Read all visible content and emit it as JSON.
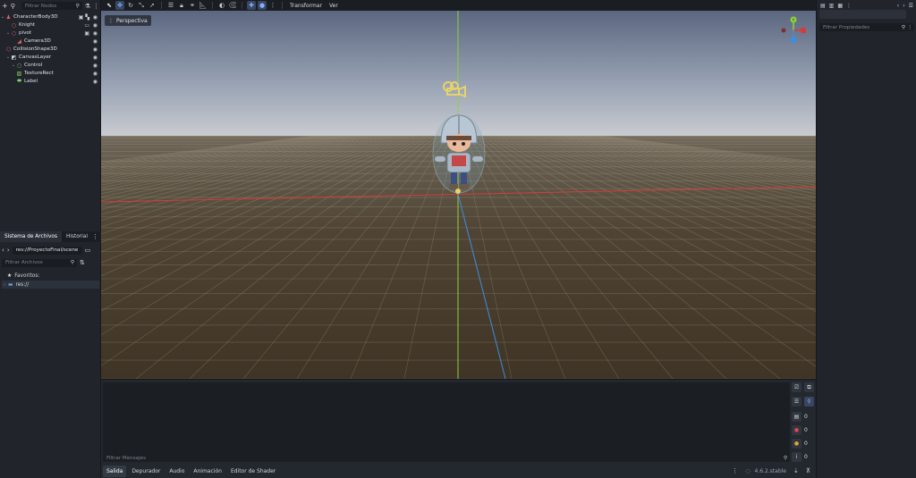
{
  "scene_panel": {
    "filter_placeholder": "Filtrar Nodos",
    "nodes": [
      {
        "label": "CharacterBody3D"
      },
      {
        "label": "Knight"
      },
      {
        "label": "pivot"
      },
      {
        "label": "Camera3D"
      },
      {
        "label": "CollisionShape3D"
      },
      {
        "label": "CanvasLayer"
      },
      {
        "label": "Control"
      },
      {
        "label": "TextureRect"
      },
      {
        "label": "Label"
      }
    ]
  },
  "filesystem_panel": {
    "tab_active": "Sistema de Archivos",
    "tab_other": "Historial",
    "path": "res://ProyectoFinal/scene",
    "filter_placeholder": "Filtrar Archivos",
    "favorites_label": "Favoritos:",
    "root_label": "res://"
  },
  "toolbar": {
    "transform_label": "Transformar",
    "view_label": "Ver"
  },
  "viewport": {
    "perspective_label": "Perspectiva",
    "gizmo_axis_label": "Y"
  },
  "inspector": {
    "filter_placeholder": "Filtrar Propiedades"
  },
  "bottom_panel": {
    "filter_placeholder": "Filtrar Mensajes",
    "counters": [
      "0",
      "0",
      "0",
      "0"
    ],
    "tabs": [
      "Salida",
      "Depurador",
      "Audio",
      "Animación",
      "Editor de Shader"
    ],
    "version": "4.6.2.stable"
  },
  "colors": {
    "accent": "#4a7fd6",
    "x_axis": "#d43c3c",
    "y_axis": "#8fd13a",
    "z_axis": "#3b8fe0",
    "error": "#e04b4b",
    "warning": "#e0a83a"
  }
}
